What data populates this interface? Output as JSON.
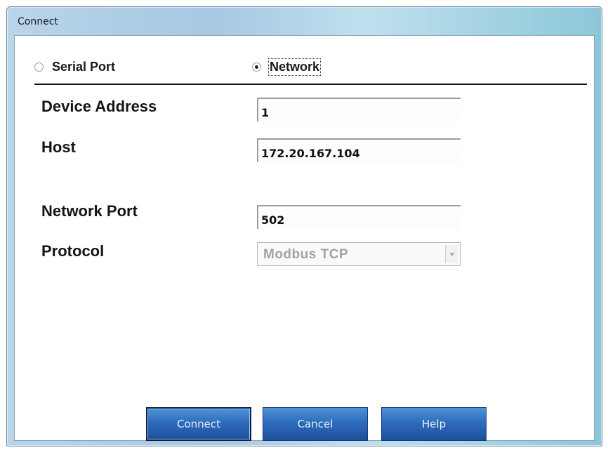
{
  "window": {
    "title": "Connect"
  },
  "connection_type": {
    "options": [
      {
        "label": "Serial Port",
        "selected": false
      },
      {
        "label": "Network",
        "selected": true
      }
    ]
  },
  "fields": {
    "device_address": {
      "label": "Device Address",
      "value": "1"
    },
    "host": {
      "label": "Host",
      "value": "172.20.167.104"
    },
    "network_port": {
      "label": "Network Port",
      "value": "502"
    },
    "protocol": {
      "label": "Protocol",
      "value": "Modbus TCP",
      "disabled": true
    }
  },
  "buttons": {
    "connect": "Connect",
    "cancel": "Cancel",
    "help": "Help"
  },
  "colors": {
    "button_blue": "#2e6dbd",
    "title_gradient": "#a6c8e3",
    "disabled_text": "#a3a3a3"
  },
  "icons": {
    "protocol_dropdown": "chevron-down-icon"
  }
}
